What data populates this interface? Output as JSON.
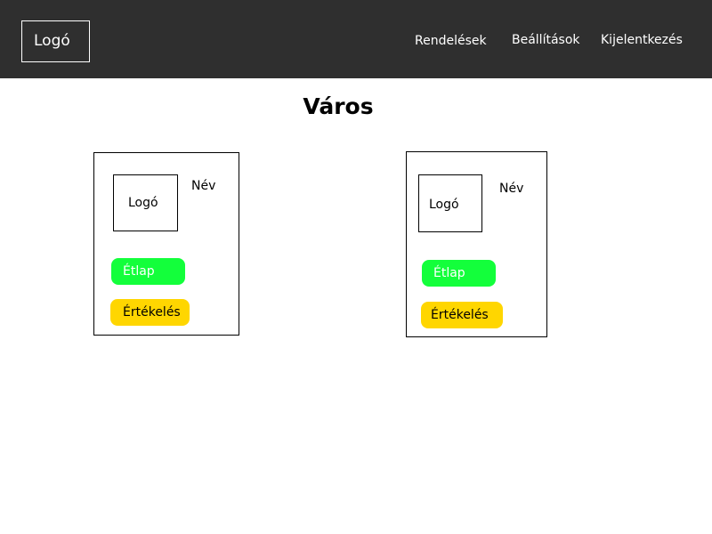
{
  "header": {
    "logo": "Logó",
    "nav": {
      "orders": "Rendelések",
      "settings": "Beállítások",
      "logout": "Kijelentkezés"
    }
  },
  "main": {
    "title": "Város",
    "restaurants": [
      {
        "logo": "Logó",
        "name": "Név",
        "menu_label": "Étlap",
        "rating_label": "Értékelés"
      },
      {
        "logo": "Logó",
        "name": "Név",
        "menu_label": "Étlap",
        "rating_label": "Értékelés"
      }
    ]
  },
  "colors": {
    "header_bg": "#2f2f2f",
    "menu_button": "#13ff3b",
    "rating_button": "#ffd600"
  }
}
